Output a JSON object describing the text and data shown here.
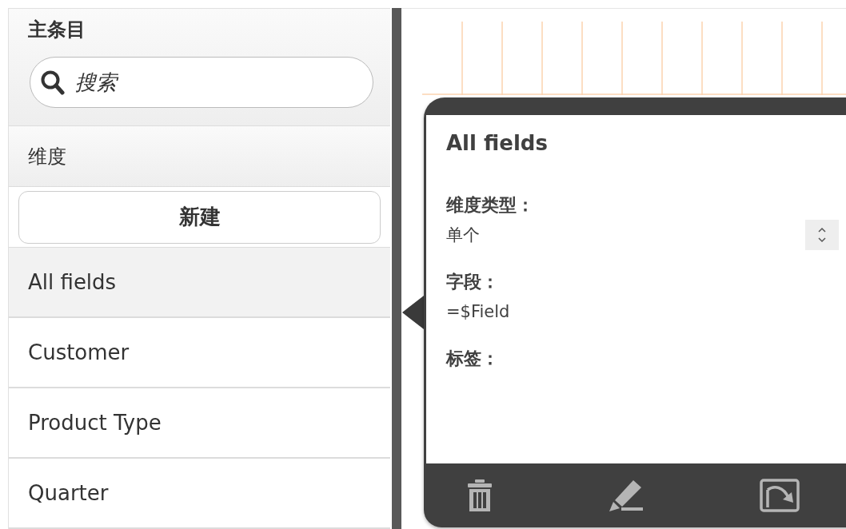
{
  "panel": {
    "title": "主条目",
    "search": {
      "placeholder": "搜索"
    },
    "section": "维度",
    "new_button": "新建",
    "items": [
      {
        "label": "All fields",
        "selected": true
      },
      {
        "label": "Customer",
        "selected": false
      },
      {
        "label": "Product Type",
        "selected": false
      },
      {
        "label": "Quarter",
        "selected": false
      }
    ]
  },
  "popup": {
    "title": "All fields",
    "fields": [
      {
        "kind": "select",
        "label": "维度类型：",
        "value": "单个"
      },
      {
        "kind": "text",
        "label": "字段：",
        "value": "=$Field"
      },
      {
        "label": "标签："
      }
    ]
  }
}
